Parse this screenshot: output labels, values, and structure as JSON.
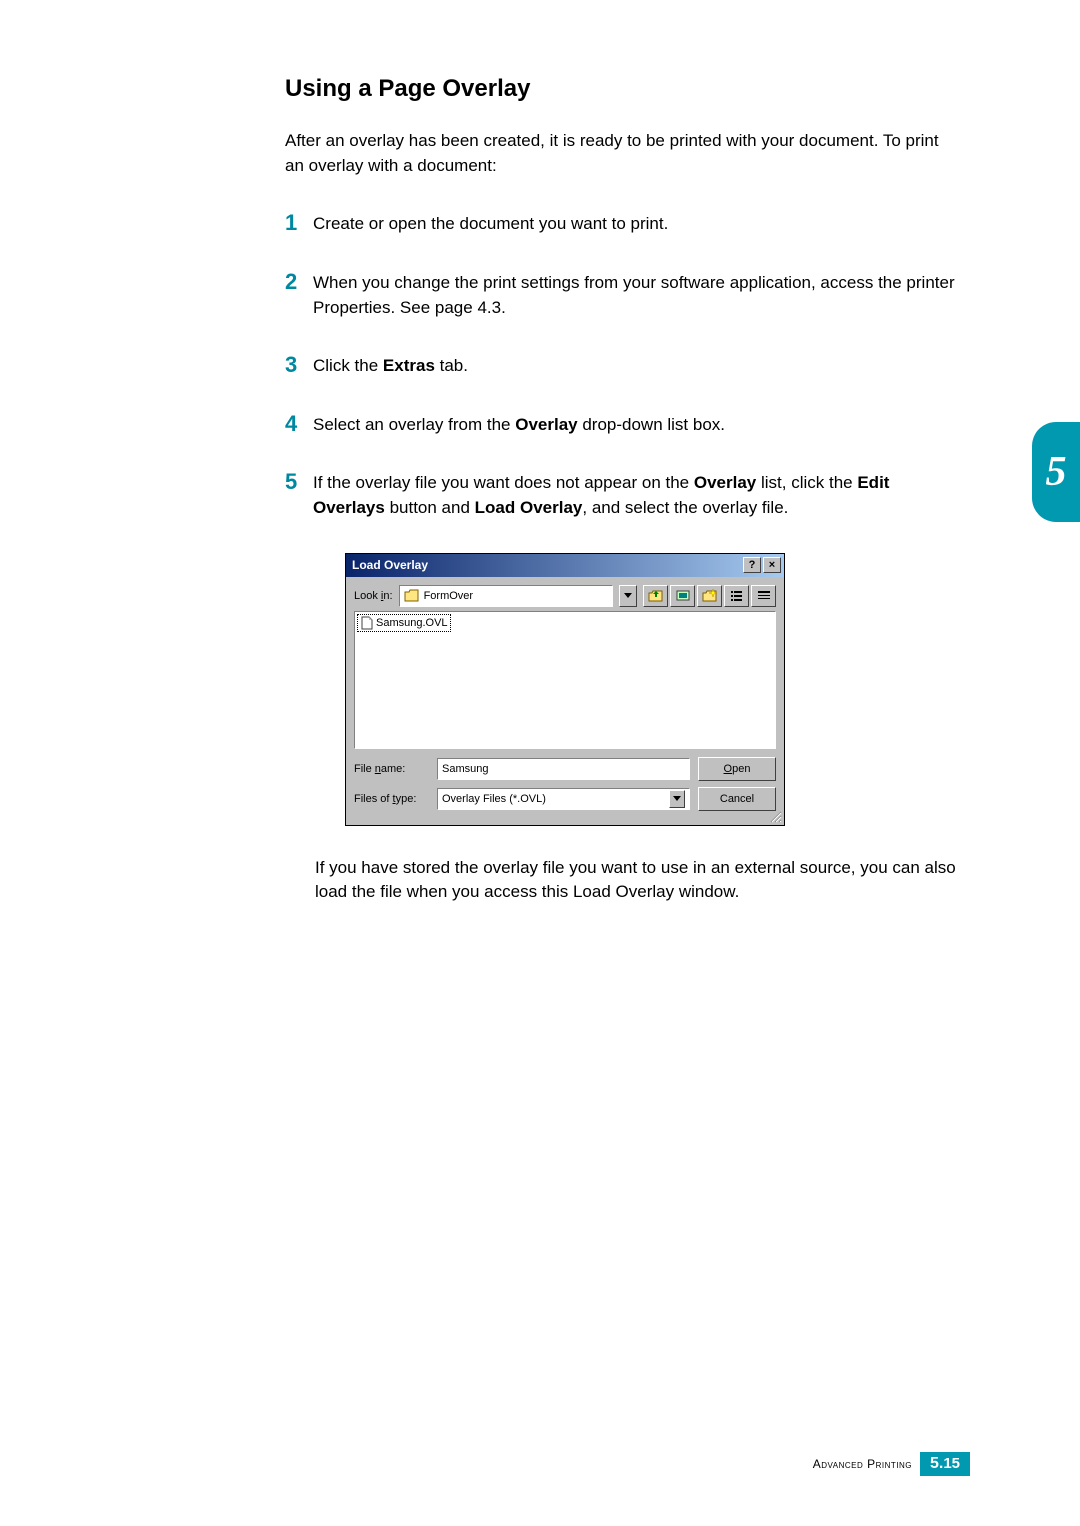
{
  "heading": "Using a Page Overlay",
  "intro": "After an overlay has been created, it is ready to be printed with your document. To print an overlay with a document:",
  "steps": [
    "Create or open the document you want to print.",
    "When you change the print settings from your software application, access the printer Properties. See page 4.3.",
    "Click the Extras tab.",
    "Select an overlay from the Overlay drop-down list box.",
    "If the overlay file you want does not appear on the Overlay list, click the Edit Overlays button and Load Overlay, and select the overlay file."
  ],
  "tab_number": "5",
  "dialog": {
    "title": "Load Overlay",
    "lookin_label": "Look in:",
    "lookin_value": "FormOver",
    "file_item": "Samsung.OVL",
    "filename_label": "File name:",
    "filename_value": "Samsung",
    "filetype_label": "Files of type:",
    "filetype_value": "Overlay Files (*.OVL)",
    "open_btn": "Open",
    "cancel_btn": "Cancel",
    "help_btn": "?",
    "close_btn": "×"
  },
  "post_text": "If you have stored the overlay file you want to use in an external source, you can also load the file when you access this Load Overlay window.",
  "footer": {
    "section_label": "Advanced Printing",
    "page_major": "5.",
    "page_minor": "15"
  }
}
